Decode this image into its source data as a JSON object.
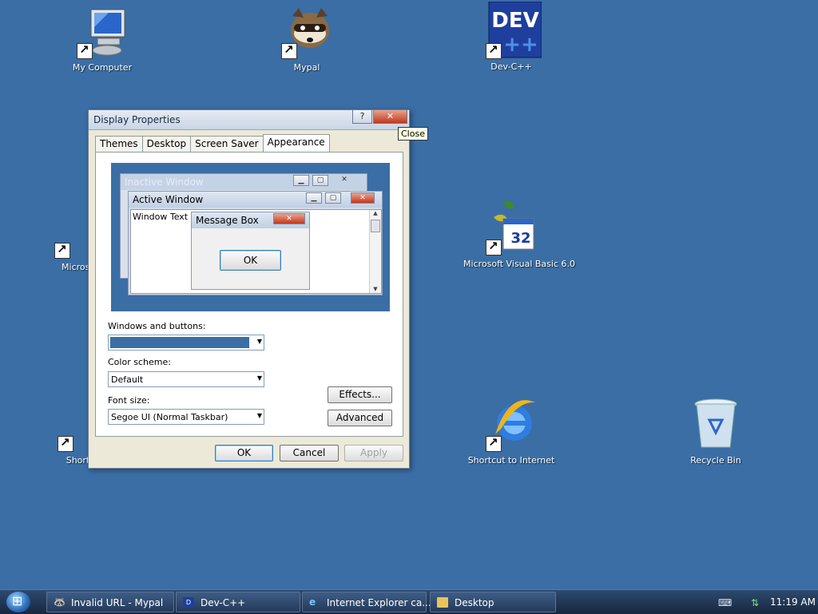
{
  "desktop": {
    "icons": [
      {
        "label": "My Computer"
      },
      {
        "label": "Mypal"
      },
      {
        "label": "Dev-C++"
      },
      {
        "label": "Microsof"
      },
      {
        "label": "Microsoft Visual Basic 6.0"
      },
      {
        "label": "Shortcu"
      },
      {
        "label": "Shortcut to Internet"
      },
      {
        "label": "Recycle Bin"
      }
    ],
    "devcpp_logo_text": "DEV",
    "vb_badge": "32"
  },
  "dialog": {
    "title": "Display Properties",
    "help_glyph": "?",
    "close_glyph": "✕",
    "close_tooltip": "Close",
    "tabs": [
      "Themes",
      "Desktop",
      "Screen Saver",
      "Appearance"
    ],
    "active_tab": "Appearance",
    "preview": {
      "inactive_title": "Inactive Window",
      "active_title": "Active Window",
      "window_text": "Window Text",
      "message_box_title": "Message Box",
      "ok_label": "OK"
    },
    "windows_buttons_label": "Windows and buttons:",
    "windows_buttons_value": "",
    "color_scheme_label": "Color scheme:",
    "color_scheme_value": "Default",
    "font_size_label": "Font size:",
    "font_size_value": "Segoe UI (Normal Taskbar)",
    "effects_label": "Effects...",
    "advanced_label": "Advanced",
    "ok_label": "OK",
    "cancel_label": "Cancel",
    "apply_label": "Apply"
  },
  "taskbar": {
    "items": [
      {
        "label": "Invalid URL - Mypal",
        "icon": "mypal-icon"
      },
      {
        "label": "Dev-C++",
        "icon": "devcpp-icon"
      },
      {
        "label": "Internet Explorer ca...",
        "icon": "ie-icon"
      },
      {
        "label": "Desktop",
        "icon": "folder-icon"
      }
    ],
    "clock": "11:19 AM"
  },
  "colors": {
    "desktop_bg": "#3a6ea5",
    "active_title_tint": "#c9d5e6",
    "close_red": "#c2381c",
    "scheme_swatch": "#3a6ea5"
  }
}
